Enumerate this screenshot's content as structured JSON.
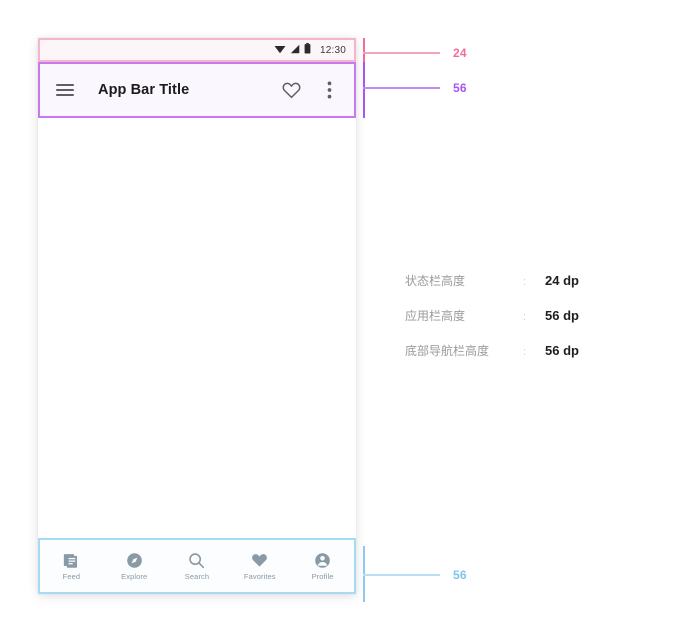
{
  "phone": {
    "status_bar": {
      "time": "12:30",
      "icons": [
        "wifi-icon",
        "signal-icon",
        "battery-icon"
      ],
      "border_color": "#f7b4cd",
      "fill_color": "#fdf6f8",
      "height_dp": "24"
    },
    "app_bar": {
      "title": "App Bar Title",
      "menu_icon": "hamburger-menu-icon",
      "action_icons": [
        "heart-outline-icon",
        "overflow-menu-icon"
      ],
      "border_color": "#c77af0",
      "fill_color": "#fbf7fe",
      "height_dp": "56"
    },
    "content": {
      "fill_color": "#ffffff"
    },
    "bottom_nav": {
      "border_color": "#a9daf5",
      "fill_color": "#fbfdff",
      "height_dp": "56",
      "items": [
        {
          "label": "Feed",
          "icon": "feed-article-icon"
        },
        {
          "label": "Explore",
          "icon": "compass-icon"
        },
        {
          "label": "Search",
          "icon": "search-icon"
        },
        {
          "label": "Favorites",
          "icon": "heart-filled-icon"
        },
        {
          "label": "Profile",
          "icon": "person-circle-icon"
        }
      ]
    }
  },
  "annotations": [
    {
      "value": "24",
      "color": "#f26d9b"
    },
    {
      "value": "56",
      "color": "#a855f7"
    },
    {
      "value": "56",
      "color": "#7fc4ec"
    }
  ],
  "legend": {
    "rows": [
      {
        "name": "状态栏高度",
        "colon": ":",
        "value": "24 dp"
      },
      {
        "name": "应用栏高度",
        "colon": ":",
        "value": "56 dp"
      },
      {
        "name": "底部导航栏高度",
        "colon": ":",
        "value": "56 dp"
      }
    ]
  }
}
